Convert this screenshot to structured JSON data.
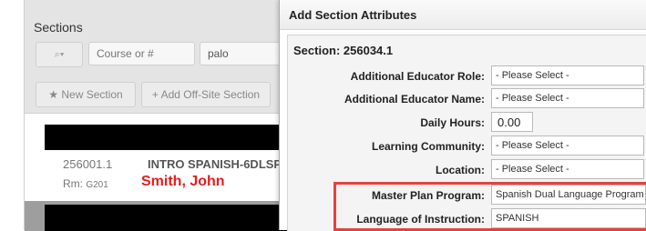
{
  "sections_panel": {
    "header": "Sections",
    "search_button_glyph": "⌕▾",
    "course_placeholder": "Course or #",
    "term_value": "palo",
    "new_section_label": "★ New Section",
    "offsite_label": "+ Add Off-Site Section",
    "rows": [
      {
        "id": "256001.1",
        "course": "INTRO SPANISH-6DLSP",
        "room_prefix": "Rm: ",
        "room": "G201",
        "teacher": "Smith, John"
      }
    ]
  },
  "dialog": {
    "title": "Add Section Attributes",
    "section_label": "Section: 256034.1",
    "fields": [
      {
        "label": "Additional Educator Role:",
        "value": "- Please Select -"
      },
      {
        "label": "Additional Educator Name:",
        "value": "- Please Select -"
      },
      {
        "label": "Daily Hours:",
        "value": "0.00"
      },
      {
        "label": "Learning Community:",
        "value": "- Please Select -"
      },
      {
        "label": "Location:",
        "value": "- Please Select -"
      },
      {
        "label": "Master Plan Program:",
        "value": "Spanish Dual Language Program"
      },
      {
        "label": "Language of Instruction:",
        "value": "SPANISH"
      }
    ]
  },
  "colors": {
    "highlight": "#e84040",
    "teacher_name": "#e21d1d"
  }
}
